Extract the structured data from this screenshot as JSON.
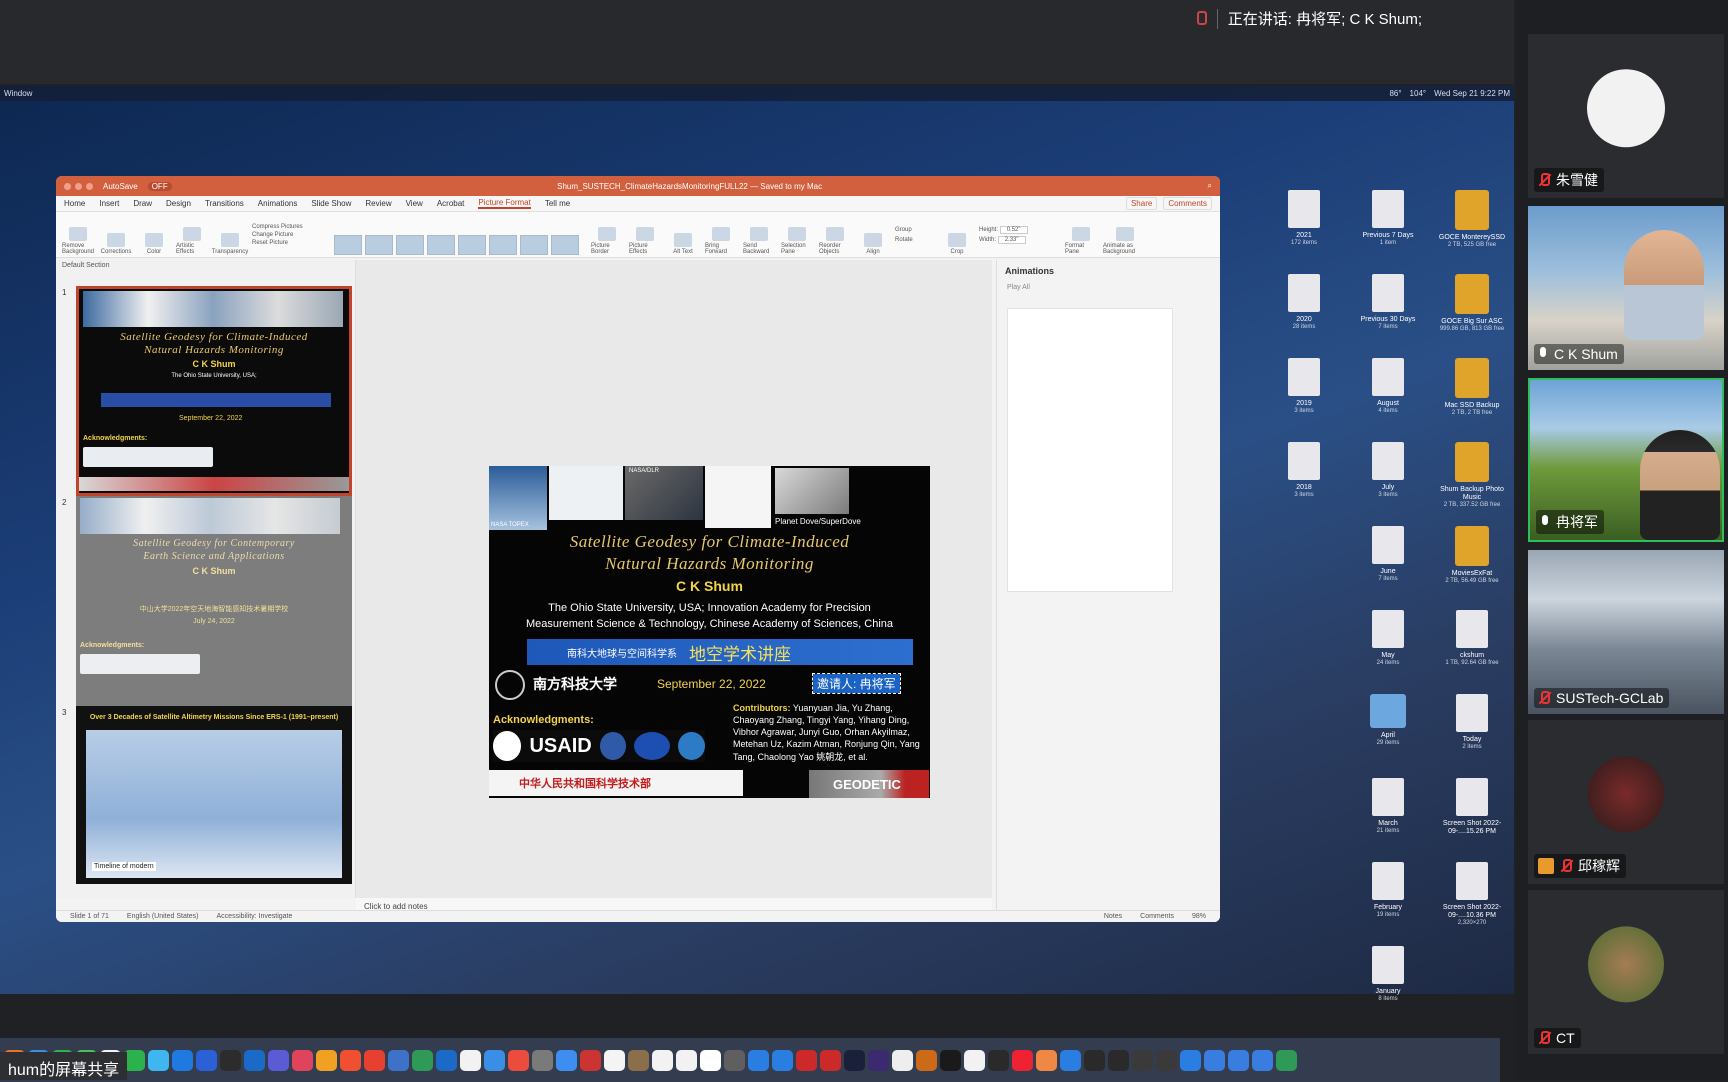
{
  "meeting": {
    "speaking_text": "正在讲话: 冉将军; C K Shum;",
    "share_label": "hum的屏幕共享"
  },
  "mac_menu": {
    "left": "Window",
    "right_items": [
      "86°",
      "104°",
      "Wed Sep 21  9:22 PM"
    ]
  },
  "powerpoint": {
    "autosave": "AutoSave",
    "autosave_state": "OFF",
    "file_title": "Shum_SUSTECH_ClimateHazardsMonitoringFULL22 — Saved to my Mac",
    "tabs": [
      "Home",
      "Insert",
      "Draw",
      "Design",
      "Transitions",
      "Animations",
      "Slide Show",
      "Review",
      "View",
      "Acrobat",
      "Picture Format",
      "Tell me"
    ],
    "active_tab": "Picture Format",
    "share": "Share",
    "comments": "Comments",
    "ribbon": {
      "remove_bg": "Remove Background",
      "corrections": "Corrections",
      "color": "Color",
      "artistic": "Artistic Effects",
      "transparency": "Transparency",
      "compress": "Compress Pictures",
      "change": "Change Picture",
      "reset": "Reset Picture",
      "border": "Picture Border",
      "effects": "Picture Effects",
      "alt": "Alt Text",
      "bring": "Bring Forward",
      "send": "Send Backward",
      "selection": "Selection Pane",
      "reorder": "Reorder Objects",
      "align": "Align",
      "group": "Group",
      "rotate": "Rotate",
      "crop": "Crop",
      "height_label": "Height:",
      "height": "0.52\"",
      "width_label": "Width:",
      "width": "2.33\"",
      "format_pane": "Format Pane",
      "animate_bg": "Animate as Background"
    },
    "section": "Default Section",
    "slides": [
      {
        "num": "1",
        "title1": "Satellite Geodesy for Climate-Induced",
        "title2": "Natural Hazards Monitoring",
        "author": "C K Shum",
        "date": "September 22, 2022",
        "ack": "Acknowledgments:"
      },
      {
        "num": "2",
        "title1": "Satellite Geodesy for Contemporary",
        "title2": "Earth Science and Applications",
        "author": "C K Shum",
        "event": "中山大学2022年空天地海智能感知技术暑期学校",
        "date": "July 24, 2022",
        "ack": "Acknowledgments:"
      },
      {
        "num": "3",
        "title": "Over 3 Decades of Satellite Altimetry Missions Since ERS-1 (1991–present)",
        "caption": "Timeline of modern"
      }
    ],
    "main_slide": {
      "planet": "Planet Dove/SuperDove",
      "nasa_topex": "NASA TOPEX",
      "nasa_dlr": "NASA/DLR",
      "title1": "Satellite Geodesy for Climate-Induced",
      "title2": "Natural Hazards Monitoring",
      "author": "C K Shum",
      "affil1": "The Ohio State University, USA;",
      "affil2": "Innovation Academy for Precision",
      "affil3": "Measurement Science & Technology, Chinese Academy of Sciences, China",
      "dept": "南科大地球与空间科学系",
      "lecture": "地空学术讲座",
      "sustech": "南方科技大学",
      "date": "September 22, 2022",
      "invite": "邀请人: 冉将军",
      "ack": "Acknowledgments:",
      "usaid": "USAID",
      "contributors_label": "Contributors:",
      "contributors": "Yuanyuan Jia, Yu Zhang, Chaoyang Zhang, Tingyi Yang, Yihang Ding, Vibhor Agrawar, Junyi Guo, Orhan Akyilmaz, Metehan Uz, Kazim Atman, Ronjung Qin, Yang Tang, Chaolong Yao 姚朝龙, et al.",
      "most": "中华人民共和国科学技术部",
      "geodetic": "GEODETIC"
    },
    "notes_placeholder": "Click to add notes",
    "animations_title": "Animations",
    "play_all": "Play All",
    "status": {
      "slide": "Slide 1 of 71",
      "lang": "English (United States)",
      "access": "Accessibility: Investigate",
      "notes": "Notes",
      "comments": "Comments",
      "zoom": "98%"
    }
  },
  "desktop_icons": [
    {
      "name": "2021",
      "sub": "172 items"
    },
    {
      "name": "Previous 7 Days",
      "sub": "1 item"
    },
    {
      "name": "GOCE MontereySSD",
      "sub": "2 TB, 525 GB free"
    },
    {
      "name": "2020",
      "sub": "28 items"
    },
    {
      "name": "Previous 30 Days",
      "sub": "7 items"
    },
    {
      "name": "GOCE Big Sur ASC",
      "sub": "999.86 GB, 813 GB free"
    },
    {
      "name": "2019",
      "sub": "3 items"
    },
    {
      "name": "August",
      "sub": "4 items"
    },
    {
      "name": "Mac SSD Backup",
      "sub": "2 TB, 2 TB free"
    },
    {
      "name": "2018",
      "sub": "3 items"
    },
    {
      "name": "July",
      "sub": "3 items"
    },
    {
      "name": "Shum Backup Photo Music",
      "sub": "2 TB, 337.52 GB free"
    },
    {
      "name": "June",
      "sub": "7 items"
    },
    {
      "name": "MoviesExFat",
      "sub": "2 TB, 56.49 GB free"
    },
    {
      "name": "May",
      "sub": "24 items"
    },
    {
      "name": "ckshum",
      "sub": "1 TB, 92.64 GB free"
    },
    {
      "name": "April",
      "sub": "29 items"
    },
    {
      "name": "Today",
      "sub": "2 items"
    },
    {
      "name": "March",
      "sub": "21 items"
    },
    {
      "name": "Screen Shot 2022-09-....15.26 PM",
      "sub": ""
    },
    {
      "name": "February",
      "sub": "19 items"
    },
    {
      "name": "Screen Shot 2022-09-....10.36 PM",
      "sub": "2,320×270"
    },
    {
      "name": "January",
      "sub": "8 items"
    }
  ],
  "participants": [
    {
      "name": "朱雪健",
      "mic": "off"
    },
    {
      "name": "C K Shum",
      "mic": "on"
    },
    {
      "name": "冉将军",
      "mic": "on"
    },
    {
      "name": "SUSTech-GCLab",
      "mic": "off"
    },
    {
      "name": "邱稼辉",
      "mic": "off"
    },
    {
      "name": "CT",
      "mic": "off"
    }
  ]
}
